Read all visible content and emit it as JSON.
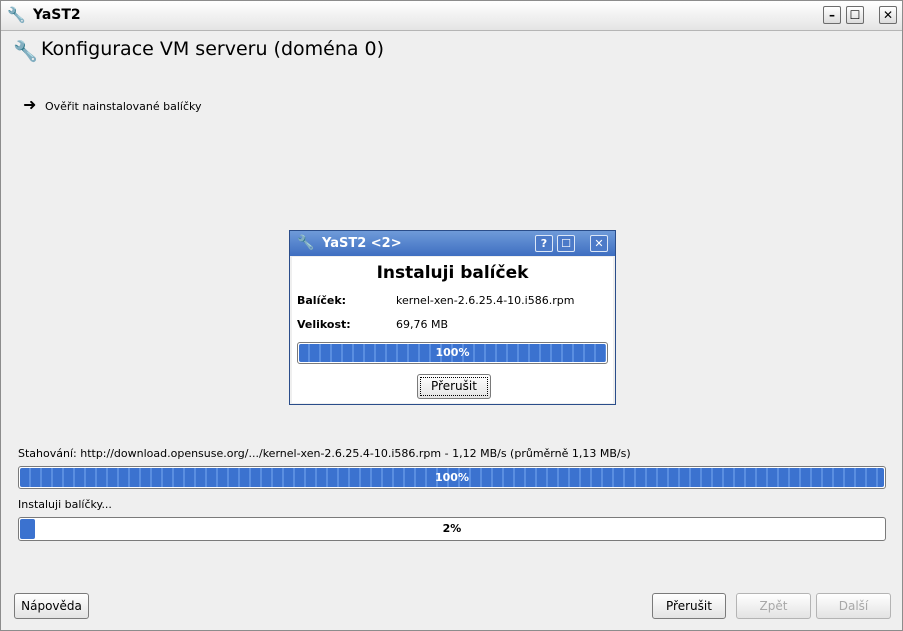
{
  "window": {
    "title": "YaST2",
    "buttons": {
      "minimize": "–",
      "maximize": "☐",
      "close": "✕"
    }
  },
  "page": {
    "heading": "Konfigurace VM serveru (doména 0)",
    "step_label": "Ověřit nainstalované balíčky"
  },
  "dialog": {
    "title": "YaST2 <2>",
    "buttons": {
      "help": "?",
      "maximize": "☐",
      "close": "✕"
    },
    "heading": "Instaluji balíček",
    "package_label": "Balíček:",
    "package_value": "kernel-xen-2.6.25.4-10.i586.rpm",
    "size_label": "Velikost:",
    "size_value": "69,76 MB",
    "progress": {
      "percent": 100,
      "text": "100%"
    },
    "abort_label": "Přerušit"
  },
  "download": {
    "label": "Stahování: http://download.opensuse.org/.../kernel-xen-2.6.25.4-10.i586.rpm - 1,12 MB/s (průměrně 1,13 MB/s)",
    "progress": {
      "percent": 100,
      "text": "100%"
    }
  },
  "install": {
    "label": "Instaluji balíčky...",
    "progress": {
      "percent": 2,
      "text": "2%"
    }
  },
  "footer": {
    "help_label": "Nápověda",
    "abort_label": "Přerušit",
    "back_label": "Zpět",
    "next_label": "Další"
  },
  "icons": {
    "app": "wrench-screwdriver-icon",
    "step_arrow": "arrow-right-icon"
  },
  "colors": {
    "progress_fill": "#3b72cf",
    "dialog_title": "#3e6ec1"
  }
}
